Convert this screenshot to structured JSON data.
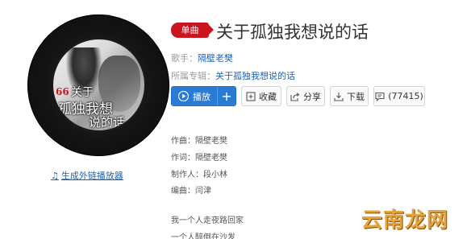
{
  "album": {
    "cover_text": {
      "quote_mark": "66",
      "line1": "关于",
      "line2": "孤独我想",
      "line3": "说的话"
    },
    "generate_player_link": "生成外链播放器",
    "generate_player_icon": "music-note-icon"
  },
  "song": {
    "type_badge": "单曲",
    "title": "关于孤独我想说的话",
    "singer_label": "歌手：",
    "singer_name": "隔壁老樊",
    "album_label": "所属专辑：",
    "album_name": "关于孤独我想说的话"
  },
  "actions": {
    "play_label": "播放",
    "add_label": "+",
    "collect_label": "收藏",
    "share_label": "分享",
    "download_label": "下载",
    "comment_count": "(77415)"
  },
  "credits": {
    "composer": "作曲：隔壁老樊",
    "lyricist": "作词：隔壁老樊",
    "producer": "制作人：段小林",
    "arranger": "编曲：闫津"
  },
  "lyrics": {
    "line1": "我一个人走夜路回家",
    "line2": "一个人醉倒在沙发"
  },
  "watermark": "云南龙网",
  "colors": {
    "badge_red": "#c9151e",
    "link_blue": "#1a62b5",
    "play_blue": "#2a7bd3",
    "watermark_orange": "#e6a43c"
  }
}
